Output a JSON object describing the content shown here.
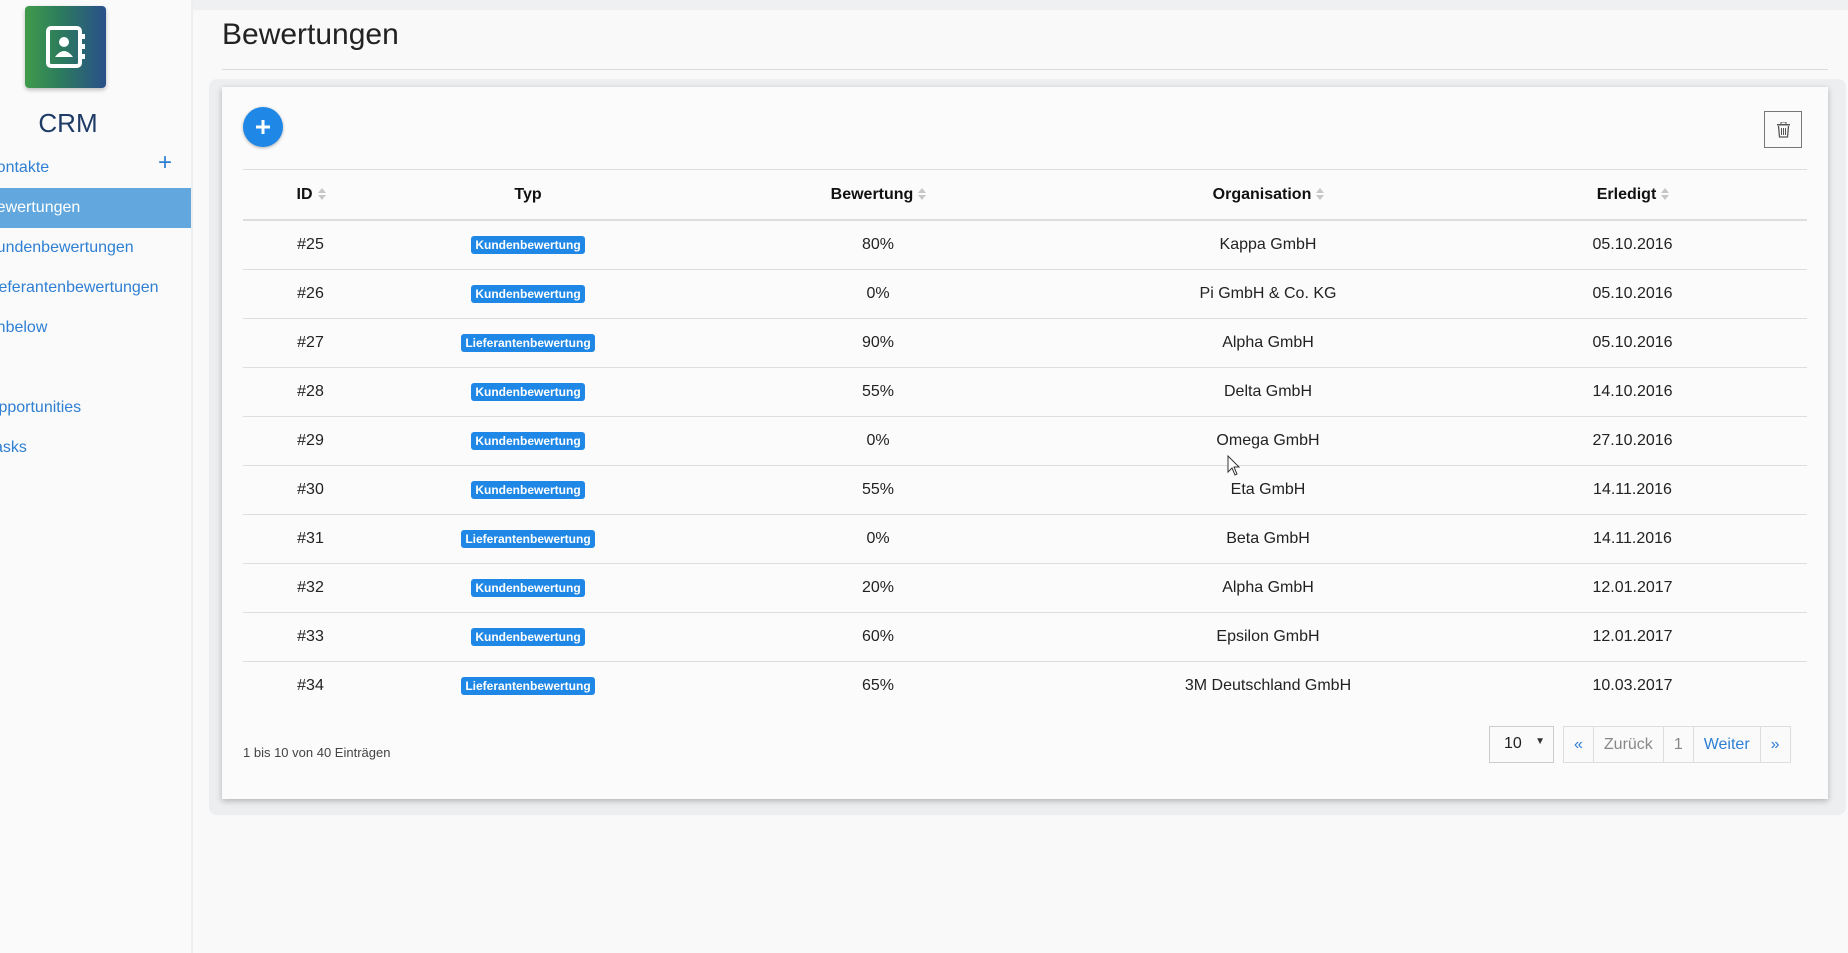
{
  "app": {
    "name": "CRM"
  },
  "sidebar": {
    "items": [
      {
        "label": "Kontakte",
        "active": false,
        "has_add": true
      },
      {
        "label": "Bewertungen",
        "active": true
      },
      {
        "label": "Kundenbewertungen",
        "active": false
      },
      {
        "label": "Lieferantenbewertungen",
        "active": false
      },
      {
        "label": "Anbelow",
        "active": false
      },
      {
        "label": "Opportunities",
        "active": false
      },
      {
        "label": "Tasks",
        "active": false
      }
    ],
    "add_symbol": "+"
  },
  "page": {
    "title": "Bewertungen"
  },
  "table": {
    "columns": [
      "ID",
      "Typ",
      "Bewertung",
      "Organisation",
      "Erledigt"
    ],
    "rows": [
      {
        "id": "#25",
        "typ": "Kundenbewertung",
        "bewertung": "80%",
        "organisation": "Kappa GmbH",
        "erledigt": "05.10.2016"
      },
      {
        "id": "#26",
        "typ": "Kundenbewertung",
        "bewertung": "0%",
        "organisation": "Pi GmbH & Co. KG",
        "erledigt": "05.10.2016"
      },
      {
        "id": "#27",
        "typ": "Lieferantenbewertung",
        "bewertung": "90%",
        "organisation": "Alpha GmbH",
        "erledigt": "05.10.2016"
      },
      {
        "id": "#28",
        "typ": "Kundenbewertung",
        "bewertung": "55%",
        "organisation": "Delta GmbH",
        "erledigt": "14.10.2016"
      },
      {
        "id": "#29",
        "typ": "Kundenbewertung",
        "bewertung": "0%",
        "organisation": "Omega GmbH",
        "erledigt": "27.10.2016"
      },
      {
        "id": "#30",
        "typ": "Kundenbewertung",
        "bewertung": "55%",
        "organisation": "Eta GmbH",
        "erledigt": "14.11.2016"
      },
      {
        "id": "#31",
        "typ": "Lieferantenbewertung",
        "bewertung": "0%",
        "organisation": "Beta GmbH",
        "erledigt": "14.11.2016"
      },
      {
        "id": "#32",
        "typ": "Kundenbewertung",
        "bewertung": "20%",
        "organisation": "Alpha GmbH",
        "erledigt": "12.01.2017"
      },
      {
        "id": "#33",
        "typ": "Kundenbewertung",
        "bewertung": "60%",
        "organisation": "Epsilon GmbH",
        "erledigt": "12.01.2017"
      },
      {
        "id": "#34",
        "typ": "Lieferantenbewertung",
        "bewertung": "65%",
        "organisation": "3M Deutschland GmbH",
        "erledigt": "10.03.2017"
      }
    ]
  },
  "footer": {
    "info": "1 bis 10 von 40 Einträgen",
    "page_length": "10",
    "pagination": {
      "first": "«",
      "prev": "Zurück",
      "current": "1",
      "next": "Weiter",
      "last": "»"
    }
  },
  "colors": {
    "accent": "#1f87e5",
    "link": "#2e7fd3",
    "active_nav": "#62a8de"
  },
  "icons": {
    "logo": "contact-book-icon",
    "add": "plus-icon",
    "delete": "trash-icon",
    "sort": "sort-icon"
  }
}
